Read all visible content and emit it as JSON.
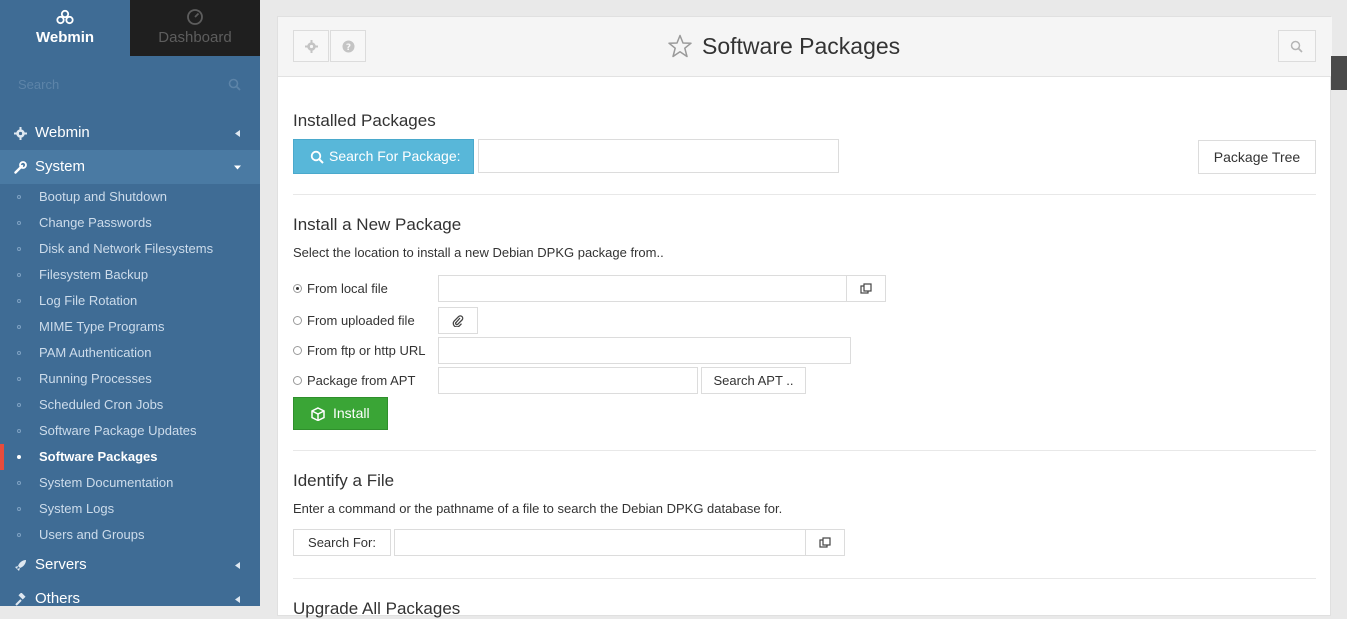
{
  "sidebar": {
    "tabs": [
      {
        "label": "Webmin",
        "icon": "webmin-logo-icon"
      },
      {
        "label": "Dashboard",
        "icon": "dashboard-gauge-icon"
      }
    ],
    "search_placeholder": "Search",
    "categories": {
      "webmin": {
        "label": "Webmin",
        "icon": "gear-icon"
      },
      "system": {
        "label": "System",
        "icon": "wrench-icon"
      },
      "servers": {
        "label": "Servers",
        "icon": "rocket-icon"
      },
      "others": {
        "label": "Others",
        "icon": "gavel-icon"
      }
    },
    "system_items": [
      "Bootup and Shutdown",
      "Change Passwords",
      "Disk and Network Filesystems",
      "Filesystem Backup",
      "Log File Rotation",
      "MIME Type Programs",
      "PAM Authentication",
      "Running Processes",
      "Scheduled Cron Jobs",
      "Software Package Updates",
      "Software Packages",
      "System Documentation",
      "System Logs",
      "Users and Groups"
    ],
    "active_item": "Software Packages",
    "colors": {
      "background": "#3f6c95",
      "active_marker": "#e74c3c",
      "dashboard_tab": "#1f1f1f"
    }
  },
  "header": {
    "title": "Software Packages",
    "icons": [
      "gear-icon",
      "help-icon",
      "star-icon",
      "search-icon"
    ]
  },
  "installed": {
    "title": "Installed Packages",
    "search_button": "Search For Package:",
    "search_value": "",
    "tree_button": "Package Tree"
  },
  "install": {
    "title": "Install a New Package",
    "description": "Select the location to install a new Debian DPKG package from..",
    "options": {
      "local": "From local file",
      "uploaded": "From uploaded file",
      "url": "From ftp or http URL",
      "apt": "Package from APT"
    },
    "selected_option": "From local file",
    "search_apt_button": "Search APT ..",
    "install_button": "Install"
  },
  "identify": {
    "title": "Identify a File",
    "description": "Enter a command or the pathname of a file to search the Debian DPKG database for.",
    "search_label": "Search For:"
  },
  "next_section": {
    "title": "Upgrade All Packages"
  },
  "colors": {
    "search_button": "#58b7d9",
    "install_button": "#3aa536"
  }
}
